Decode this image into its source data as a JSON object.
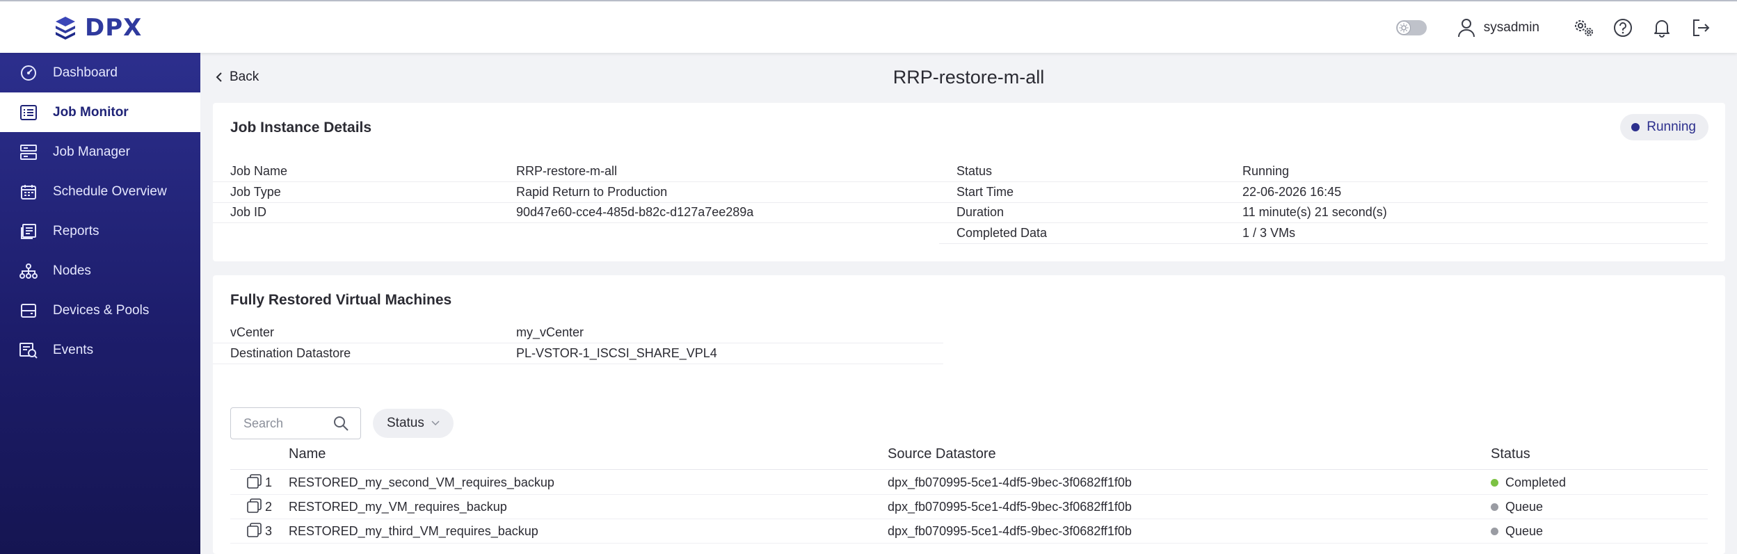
{
  "app": {
    "logo_text": "DPX"
  },
  "topbar": {
    "username": "sysadmin"
  },
  "sidebar": {
    "items": [
      {
        "label": "Dashboard",
        "icon": "dashboard-icon",
        "active": false
      },
      {
        "label": "Job Monitor",
        "icon": "job-monitor-icon",
        "active": true
      },
      {
        "label": "Job Manager",
        "icon": "job-manager-icon",
        "active": false
      },
      {
        "label": "Schedule Overview",
        "icon": "calendar-icon",
        "active": false
      },
      {
        "label": "Reports",
        "icon": "reports-icon",
        "active": false
      },
      {
        "label": "Nodes",
        "icon": "nodes-icon",
        "active": false
      },
      {
        "label": "Devices & Pools",
        "icon": "devices-icon",
        "active": false
      },
      {
        "label": "Events",
        "icon": "events-icon",
        "active": false
      }
    ]
  },
  "header": {
    "back_label": "Back",
    "title": "RRP-restore-m-all"
  },
  "job_details": {
    "title": "Job Instance Details",
    "badge": "Running",
    "left": [
      {
        "key": "Job Name",
        "value": "RRP-restore-m-all"
      },
      {
        "key": "Job Type",
        "value": "Rapid Return to Production"
      },
      {
        "key": "Job ID",
        "value": "90d47e60-cce4-485d-b82c-d127a7ee289a"
      }
    ],
    "right": [
      {
        "key": "Status",
        "value": "Running"
      },
      {
        "key": "Start Time",
        "value": "22-06-2026 16:45"
      },
      {
        "key": "Duration",
        "value": "11 minute(s) 21 second(s)"
      },
      {
        "key": "Completed Data",
        "value": "1 / 3 VMs"
      }
    ]
  },
  "restored": {
    "title": "Fully Restored Virtual Machines",
    "fields": [
      {
        "key": "vCenter",
        "value": "my_vCenter"
      },
      {
        "key": "Destination Datastore",
        "value": "PL-VSTOR-1_ISCSI_SHARE_VPL4"
      }
    ],
    "search_placeholder": "Search",
    "status_filter": "Status",
    "columns": {
      "name": "Name",
      "source": "Source Datastore",
      "status": "Status"
    },
    "rows": [
      {
        "index": "1",
        "name": "RESTORED_my_second_VM_requires_backup",
        "source": "dpx_fb070995-5ce1-4df5-9bec-3f0682ff1f0b",
        "status": "Completed",
        "status_color": "#7cc243"
      },
      {
        "index": "2",
        "name": "RESTORED_my_VM_requires_backup",
        "source": "dpx_fb070995-5ce1-4df5-9bec-3f0682ff1f0b",
        "status": "Queue",
        "status_color": "#9a9ca3"
      },
      {
        "index": "3",
        "name": "RESTORED_my_third_VM_requires_backup",
        "source": "dpx_fb070995-5ce1-4df5-9bec-3f0682ff1f0b",
        "status": "Queue",
        "status_color": "#9a9ca3"
      }
    ]
  },
  "colors": {
    "primary": "#2c2f8d",
    "sidebar_dark": "#151552",
    "completed": "#7cc243",
    "queue": "#9a9ca3"
  }
}
